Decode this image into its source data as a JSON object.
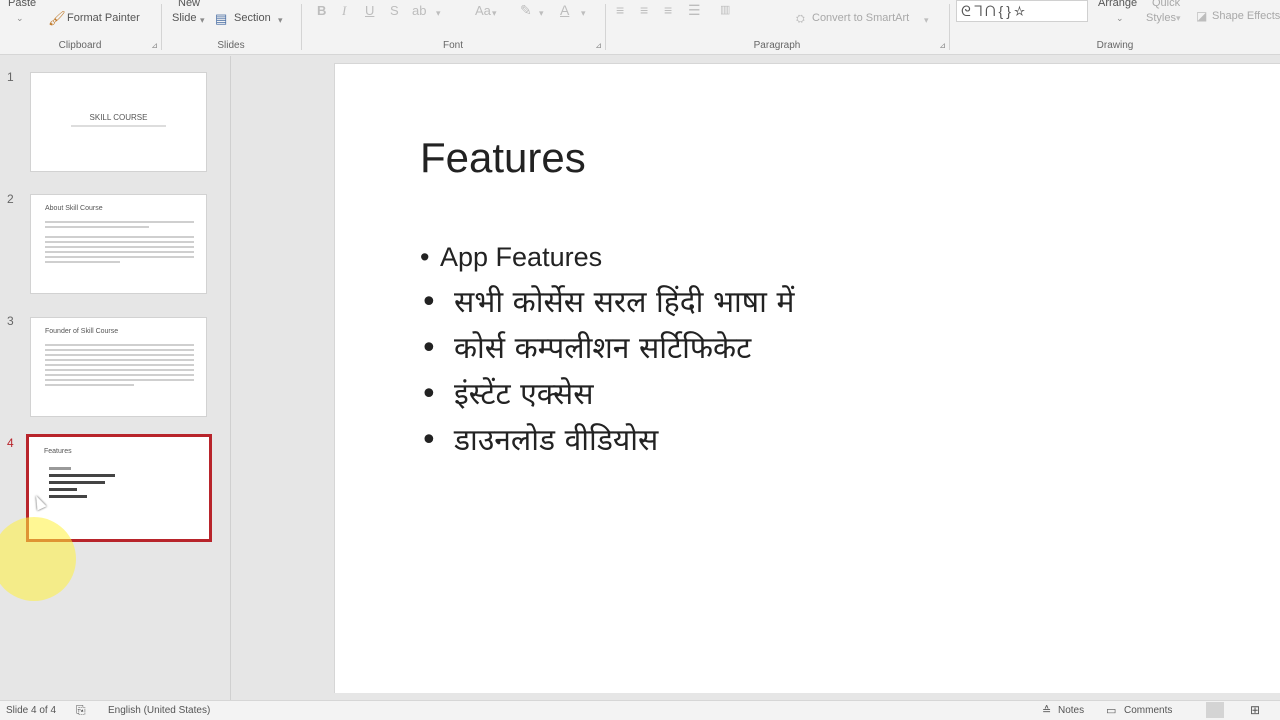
{
  "ribbon": {
    "clipboard": {
      "paste": "Paste",
      "format_painter": "Format Painter",
      "label": "Clipboard"
    },
    "slides": {
      "new_slide_top": "New",
      "new_slide": "Slide",
      "section": "Section",
      "label": "Slides"
    },
    "font": {
      "bold": "B",
      "italic": "I",
      "underline": "U",
      "strike": "S",
      "case": "Aa",
      "font_color": "A",
      "label": "Font"
    },
    "paragraph": {
      "convert_smartart": "Convert to SmartArt",
      "label": "Paragraph"
    },
    "drawing": {
      "shapes": "ᘓᒣᑎ{}☆",
      "arrange": "Arrange",
      "quick_styles_top": "Quick",
      "quick_styles": "Styles",
      "shape_effects": "Shape Effects",
      "label": "Drawing"
    }
  },
  "thumbnails": [
    {
      "number": "1",
      "title": "SKILL COURSE"
    },
    {
      "number": "2",
      "title": "About Skill Course"
    },
    {
      "number": "3",
      "title": "Founder of Skill Course"
    },
    {
      "number": "4",
      "title": "Features"
    }
  ],
  "slide": {
    "title": "Features",
    "bullets": [
      "App Features",
      "सभी कोर्सेस सरल हिंदी भाषा में",
      "कोर्स कम्पलीशन सर्टिफिकेट",
      "इंस्टेंट एक्सेस",
      "डाउनलोड वीडियोस"
    ]
  },
  "status": {
    "slide_counter": "Slide 4 of 4",
    "language": "English (United States)",
    "notes": "Notes",
    "comments": "Comments"
  },
  "colors": {
    "selected_border": "#b8242b",
    "cursor_highlight": "#fff03c"
  }
}
